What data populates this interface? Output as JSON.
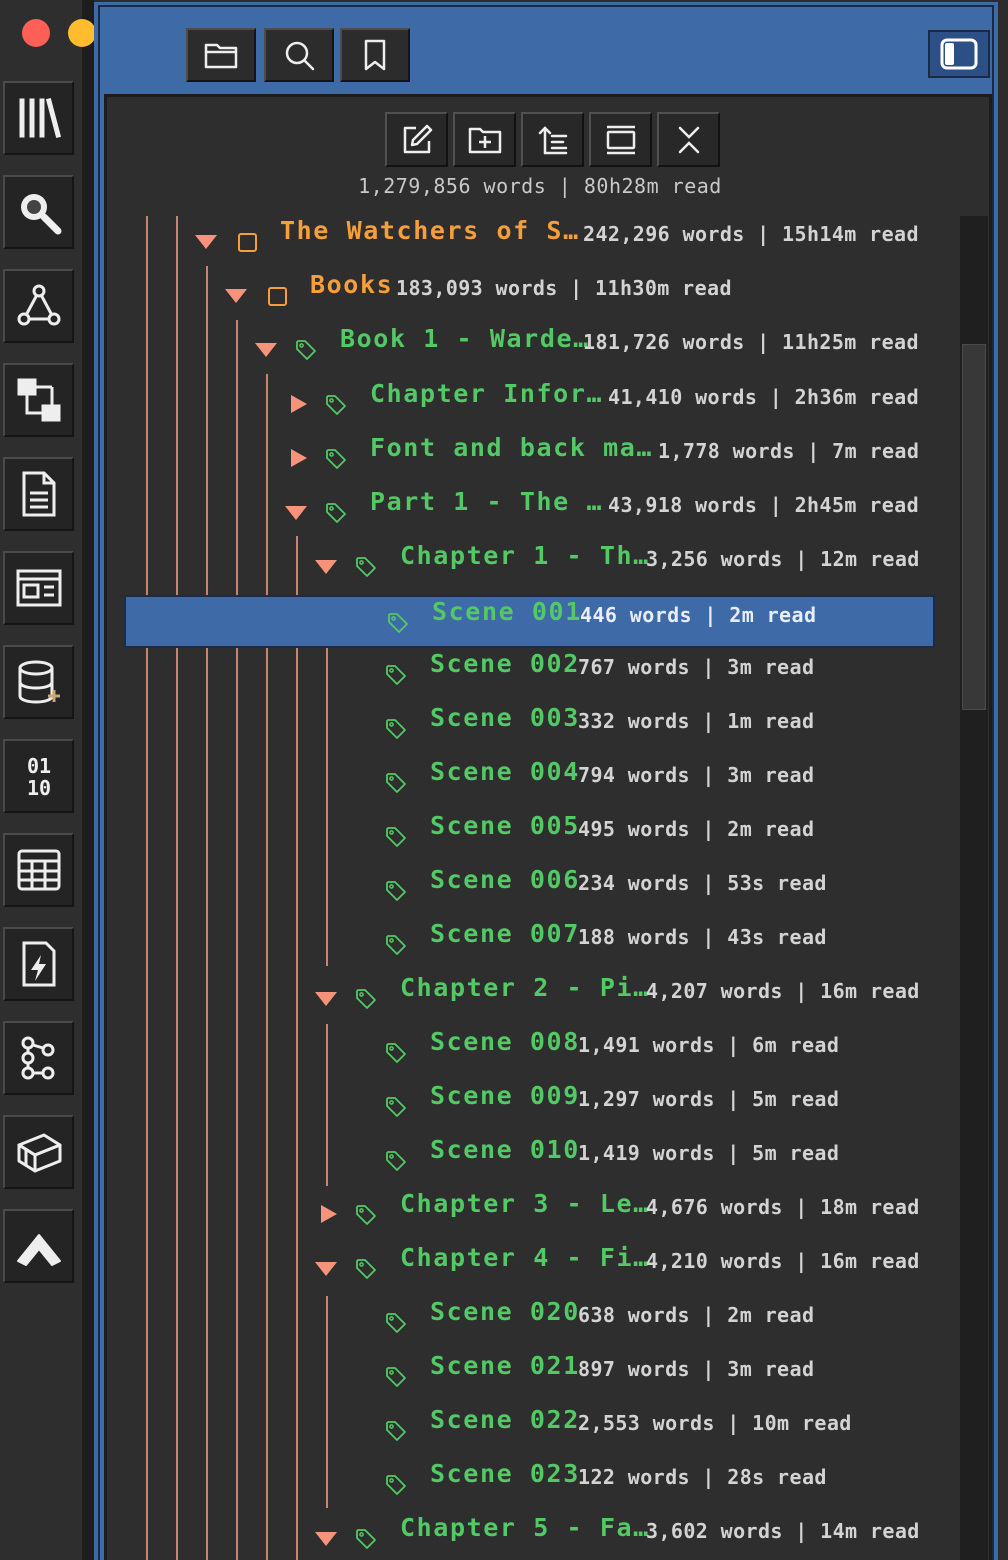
{
  "toolbar": {
    "top_buttons": [
      "folder-icon",
      "search-icon",
      "bookmark-icon"
    ],
    "tools": [
      "edit-icon",
      "new-folder-icon",
      "sort-icon",
      "collapse-icon",
      "close-icon"
    ]
  },
  "sidebar_icons": [
    "library-icon",
    "search-icon",
    "graph-icon",
    "outline-icon",
    "document-icon",
    "layout-icon",
    "database-icon",
    "binary-icon",
    "table-icon",
    "script-icon",
    "tree-icon",
    "box-icon",
    "up-arrow-icon"
  ],
  "summary": "1,279,856 words | 80h28m read",
  "tree": [
    {
      "title": "The Watchers of S…",
      "meta": "242,296 words | 15h14m read"
    },
    {
      "title": "Books",
      "meta": "183,093 words | 11h30m read"
    },
    {
      "title": "Book 1 - Warde…",
      "meta": "181,726 words | 11h25m read"
    },
    {
      "title": "Chapter Infor…",
      "meta": "41,410 words | 2h36m read"
    },
    {
      "title": "Font and back ma…",
      "meta": "1,778 words | 7m read"
    },
    {
      "title": "Part 1 - The …",
      "meta": "43,918 words | 2h45m read"
    },
    {
      "title": "Chapter 1 - Th…",
      "meta": "3,256 words | 12m read"
    },
    {
      "title": "Scene 001",
      "meta": "446 words | 2m read"
    },
    {
      "title": "Scene 002",
      "meta": "767 words | 3m read"
    },
    {
      "title": "Scene 003",
      "meta": "332 words | 1m read"
    },
    {
      "title": "Scene 004",
      "meta": "794 words | 3m read"
    },
    {
      "title": "Scene 005",
      "meta": "495 words | 2m read"
    },
    {
      "title": "Scene 006",
      "meta": "234 words | 53s read"
    },
    {
      "title": "Scene 007",
      "meta": "188 words | 43s read"
    },
    {
      "title": "Chapter 2 - Pi…",
      "meta": "4,207 words | 16m read"
    },
    {
      "title": "Scene 008",
      "meta": "1,491 words | 6m read"
    },
    {
      "title": "Scene 009",
      "meta": "1,297 words | 5m read"
    },
    {
      "title": "Scene 010",
      "meta": "1,419 words | 5m read"
    },
    {
      "title": "Chapter 3 - Le…",
      "meta": "4,676 words | 18m read"
    },
    {
      "title": "Chapter 4 - Fi…",
      "meta": "4,210 words | 16m read"
    },
    {
      "title": "Scene 020",
      "meta": "638 words | 2m read"
    },
    {
      "title": "Scene 021",
      "meta": "897 words | 3m read"
    },
    {
      "title": "Scene 022",
      "meta": "2,553 words | 10m read"
    },
    {
      "title": "Scene 023",
      "meta": "122 words | 28s read"
    },
    {
      "title": "Chapter 5 - Fa…",
      "meta": "3,602 words | 14m read"
    }
  ],
  "colors": {
    "panel_blue": "#3f6aa8",
    "folder_orange": "#f59f3a",
    "tag_green": "#52c965",
    "triangle_salmon": "#f8937b"
  }
}
